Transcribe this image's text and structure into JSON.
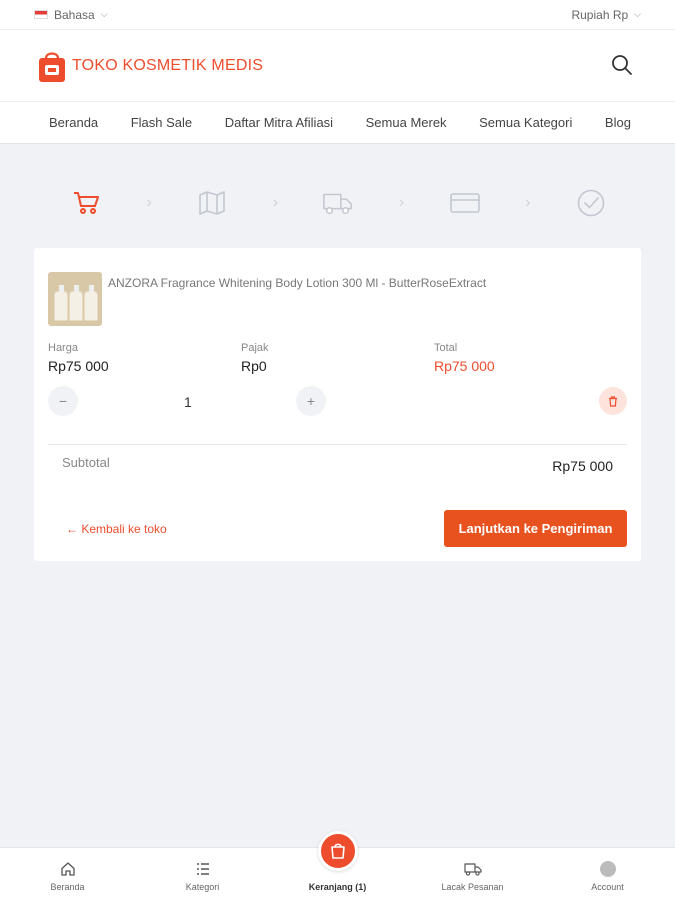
{
  "topbar": {
    "language": "Bahasa",
    "currency": "Rupiah Rp"
  },
  "brand": {
    "name": "TOKO KOSMETIK MEDIS",
    "color": "#ee4d2d"
  },
  "nav": [
    "Beranda",
    "Flash Sale",
    "Daftar Mitra Afiliasi",
    "Semua Merek",
    "Semua Kategori",
    "Blog"
  ],
  "steps": [
    {
      "icon": "cart-icon",
      "active": true
    },
    {
      "icon": "map-icon",
      "active": false
    },
    {
      "icon": "truck-icon",
      "active": false
    },
    {
      "icon": "credit-card-icon",
      "active": false
    },
    {
      "icon": "check-circle-icon",
      "active": false
    }
  ],
  "cart": {
    "item": {
      "name": "ANZORA Fragrance Whitening Body Lotion 300 Ml - ButterRoseExtract",
      "price_label": "Harga",
      "price": "Rp75 000",
      "tax_label": "Pajak",
      "tax": "Rp0",
      "total_label": "Total",
      "total": "Rp75 000",
      "qty": "1",
      "qty_minus": "−",
      "qty_plus": "+"
    },
    "subtotal_label": "Subtotal",
    "subtotal": "Rp75 000",
    "back_label": "← Kembali ke toko",
    "cta_label": "Lanjutkan ke Pengiriman"
  },
  "bottom_nav": {
    "home": "Beranda",
    "category": "Kategori",
    "cart": "Keranjang (1)",
    "track": "Lacak Pesanan",
    "account": "Account"
  },
  "colors": {
    "accent": "#ee4d2d",
    "cta": "#e8521f",
    "background": "#f1f2f6"
  }
}
